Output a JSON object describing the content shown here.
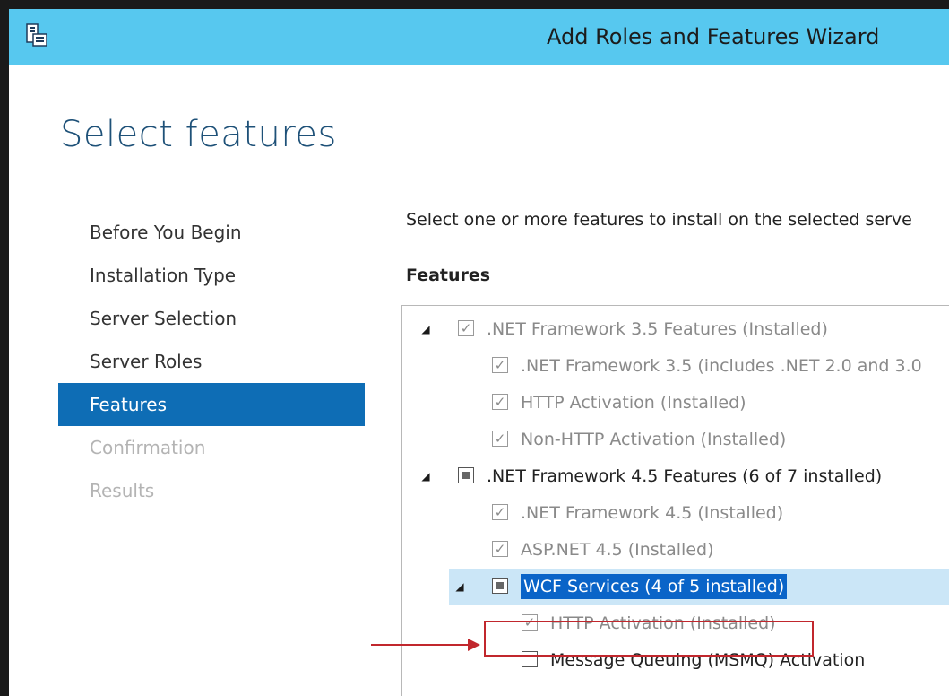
{
  "window": {
    "title": "Add Roles and Features Wizard",
    "titlebar_color": "#57c8ef"
  },
  "page": {
    "title": "Select features",
    "instruction": "Select one or more features to install on the selected serve",
    "features_label": "Features"
  },
  "nav": {
    "items": [
      {
        "label": "Before You Begin",
        "state": "normal"
      },
      {
        "label": "Installation Type",
        "state": "normal"
      },
      {
        "label": "Server Selection",
        "state": "normal"
      },
      {
        "label": "Server Roles",
        "state": "normal"
      },
      {
        "label": "Features",
        "state": "active"
      },
      {
        "label": "Confirmation",
        "state": "disabled"
      },
      {
        "label": "Results",
        "state": "disabled"
      }
    ],
    "active_color": "#0e6db5"
  },
  "features": {
    "items": [
      {
        "label": ".NET Framework 3.5 Features (Installed)",
        "check": "checked-disabled",
        "expander": "◢"
      },
      {
        "label": ".NET Framework 3.5 (includes .NET 2.0 and 3.0",
        "check": "checked-disabled"
      },
      {
        "label": "HTTP Activation (Installed)",
        "check": "checked-disabled"
      },
      {
        "label": "Non-HTTP Activation (Installed)",
        "check": "checked-disabled"
      },
      {
        "label": ".NET Framework 4.5 Features (6 of 7 installed)",
        "check": "partial",
        "expander": "◢"
      },
      {
        "label": ".NET Framework 4.5 (Installed)",
        "check": "checked-disabled"
      },
      {
        "label": "ASP.NET 4.5 (Installed)",
        "check": "checked-disabled"
      },
      {
        "label": "WCF Services (4 of 5 installed)",
        "check": "partial",
        "expander": "◢",
        "selected": true
      },
      {
        "label": "HTTP Activation (Installed)",
        "check": "checked-disabled",
        "highlighted": true
      },
      {
        "label": "Message Queuing (MSMQ) Activation",
        "check": "unchecked"
      }
    ]
  },
  "annotation": {
    "color": "#c1272d"
  },
  "icons": {
    "app": "wizard-app-icon",
    "checkmark": "✓"
  }
}
